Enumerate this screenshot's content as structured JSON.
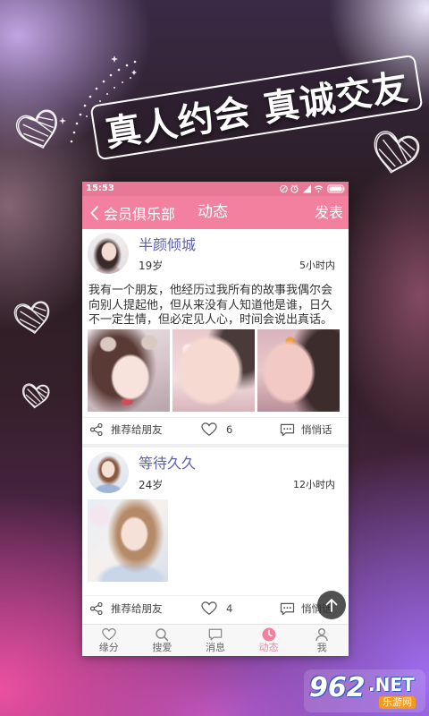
{
  "banner": {
    "text": "真人约会 真诚交友"
  },
  "status_bar": {
    "time": "15:53",
    "icons": [
      "no-sim-icon",
      "alarm-icon",
      "signal-icon",
      "wifi-icon",
      "battery-icon"
    ]
  },
  "header": {
    "back_label": "会员俱乐部",
    "title": "动态",
    "action_label": "发表"
  },
  "posts": [
    {
      "name": "半颜倾城",
      "age": "19岁",
      "time": "5小时内",
      "text": "我有一个朋友，他经历过我所有的故事我偶尔会向别人提起他，但从来没有人知道他是谁，日久不一定生情，但必定见人心，时间会说出真话。",
      "share_label": "推荐给朋友",
      "likes": "6",
      "whisper_label": "悄悄话"
    },
    {
      "name": "等待久久",
      "age": "24岁",
      "time": "12小时内",
      "share_label": "推荐给朋友",
      "likes": "4",
      "whisper_label": "悄悄话"
    }
  ],
  "tabs": [
    {
      "label": "缘分",
      "icon": "heart-icon",
      "active": false
    },
    {
      "label": "搜爱",
      "icon": "search-icon",
      "active": false
    },
    {
      "label": "消息",
      "icon": "message-icon",
      "active": false
    },
    {
      "label": "动态",
      "icon": "moments-clock-icon",
      "active": true
    },
    {
      "label": "我",
      "icon": "profile-icon",
      "active": false
    }
  ],
  "watermark": {
    "number": "962",
    "suffix": ".NET",
    "sub": "乐游网"
  },
  "colors": {
    "accent": "#f4809f",
    "name": "#5b62a8"
  }
}
